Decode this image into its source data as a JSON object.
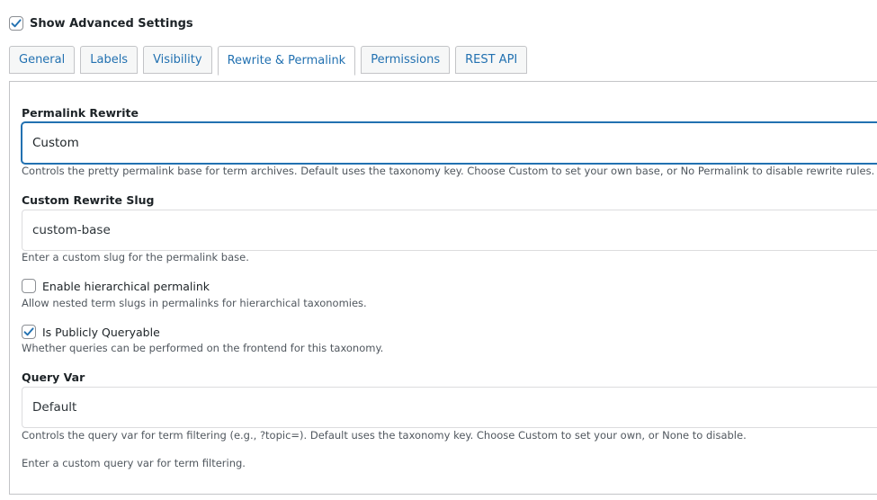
{
  "advanced_settings": {
    "label": "Show Advanced Settings",
    "checked": true
  },
  "tabs": [
    {
      "label": "General",
      "active": false
    },
    {
      "label": "Labels",
      "active": false
    },
    {
      "label": "Visibility",
      "active": false
    },
    {
      "label": "Rewrite & Permalink",
      "active": true
    },
    {
      "label": "Permissions",
      "active": false
    },
    {
      "label": "REST API",
      "active": false
    }
  ],
  "permalink_rewrite": {
    "label": "Permalink Rewrite",
    "value": "Custom",
    "description": "Controls the pretty permalink base for term archives. Default uses the taxonomy key. Choose Custom to set your own base, or No Permalink to disable rewrite rules."
  },
  "custom_rewrite_slug": {
    "label": "Custom Rewrite Slug",
    "value": "custom-base",
    "description": "Enter a custom slug for the permalink base."
  },
  "hierarchical_permalink": {
    "label": "Enable hierarchical permalink",
    "checked": false,
    "description": "Allow nested term slugs in permalinks for hierarchical taxonomies."
  },
  "publicly_queryable": {
    "label": "Is Publicly Queryable",
    "checked": true,
    "description": "Whether queries can be performed on the frontend for this taxonomy."
  },
  "query_var": {
    "label": "Query Var",
    "value": "Default",
    "description": "Controls the query var for term filtering (e.g., ?topic=). Default uses the taxonomy key. Choose Custom to set your own, or None to disable.",
    "custom_description": "Enter a custom query var for term filtering."
  },
  "colors": {
    "accent": "#2271b1",
    "border": "#c3c4c7",
    "text": "#1d2327",
    "muted": "#50575e"
  }
}
